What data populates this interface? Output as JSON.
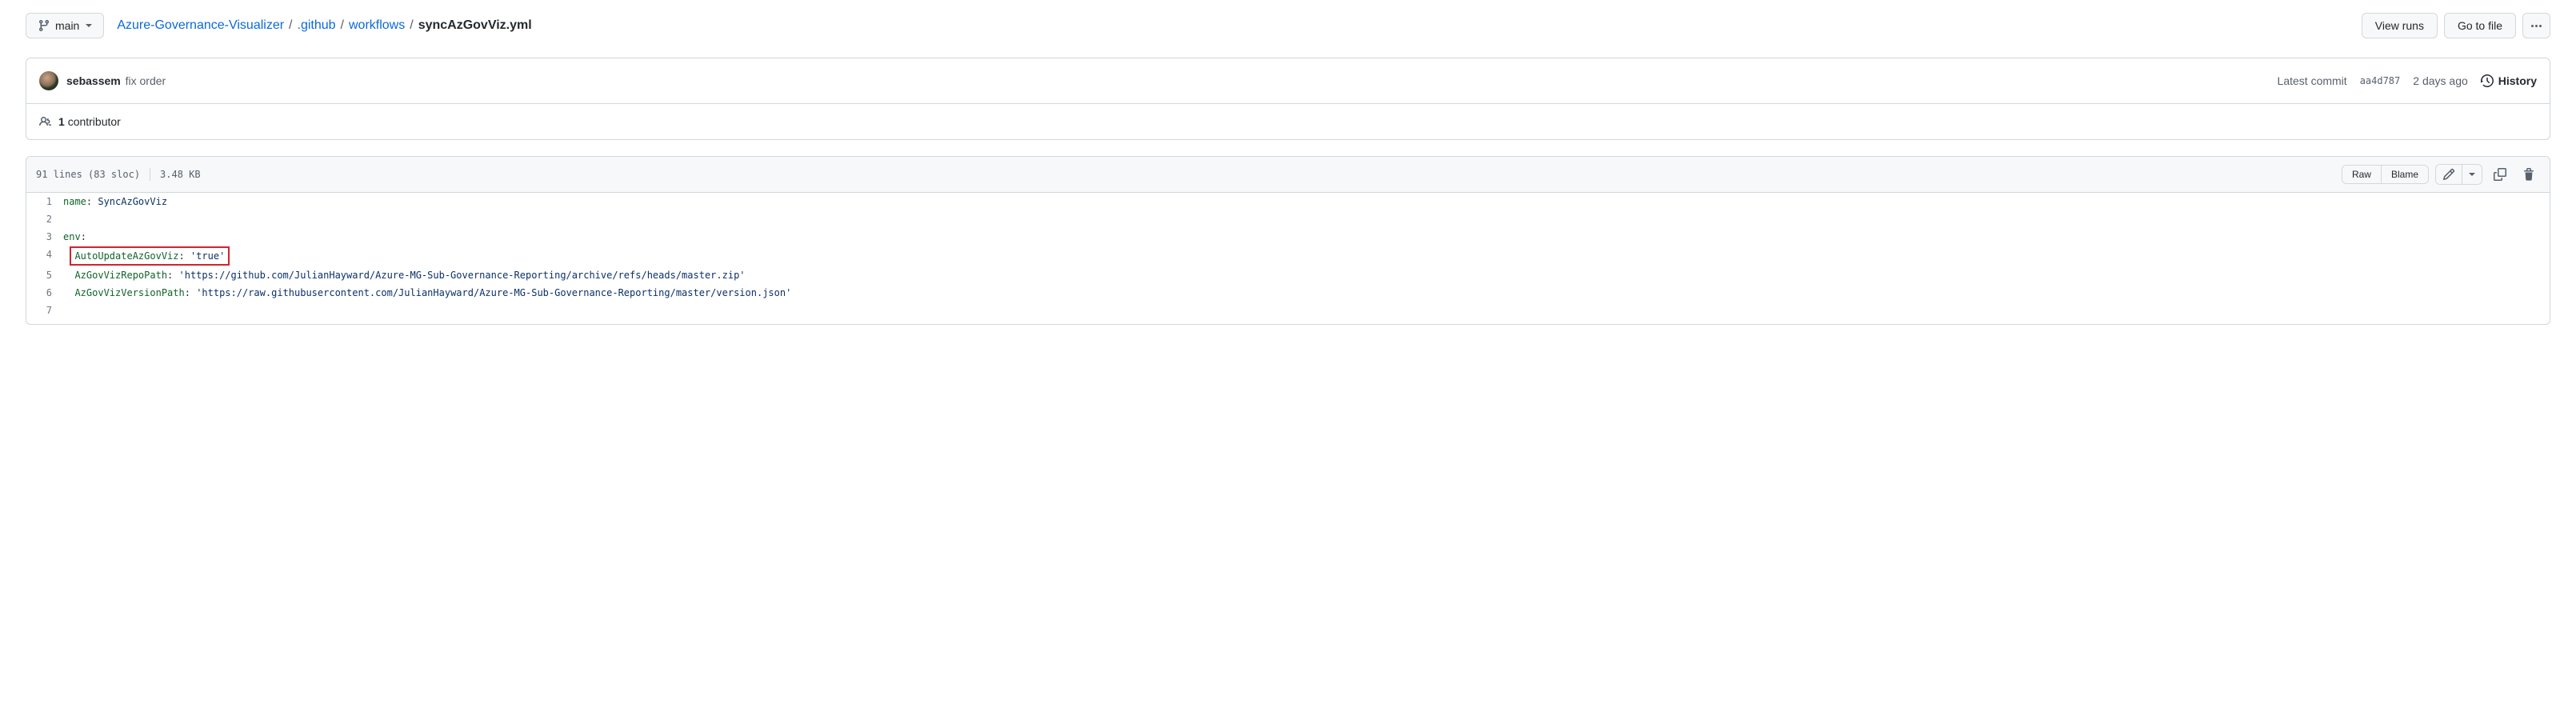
{
  "branch": {
    "label": "main"
  },
  "breadcrumbs": {
    "repo": "Azure-Governance-Visualizer",
    "parts": [
      ".github",
      "workflows"
    ],
    "file": "syncAzGovViz.yml"
  },
  "actions": {
    "view_runs": "View runs",
    "go_to_file": "Go to file"
  },
  "commit": {
    "author": "sebassem",
    "message": "fix order",
    "latest_label": "Latest commit",
    "sha": "aa4d787",
    "when": "2 days ago",
    "history": "History"
  },
  "contrib": {
    "count": "1",
    "label": "contributor"
  },
  "filestats": {
    "lines": "91 lines (83 sloc)",
    "size": "3.48 KB"
  },
  "codeactions": {
    "raw": "Raw",
    "blame": "Blame"
  },
  "code": {
    "l1_key": "name",
    "l1_val": "SyncAzGovViz",
    "l3_key": "env",
    "l4_key": "AutoUpdateAzGovViz",
    "l4_val": "'true'",
    "l5_key": "AzGovVizRepoPath",
    "l5_val": "'https://github.com/JulianHayward/Azure-MG-Sub-Governance-Reporting/archive/refs/heads/master.zip'",
    "l6_key": "AzGovVizVersionPath",
    "l6_val": "'https://raw.githubusercontent.com/JulianHayward/Azure-MG-Sub-Governance-Reporting/master/version.json'"
  },
  "line_numbers": {
    "n1": "1",
    "n2": "2",
    "n3": "3",
    "n4": "4",
    "n5": "5",
    "n6": "6",
    "n7": "7"
  }
}
